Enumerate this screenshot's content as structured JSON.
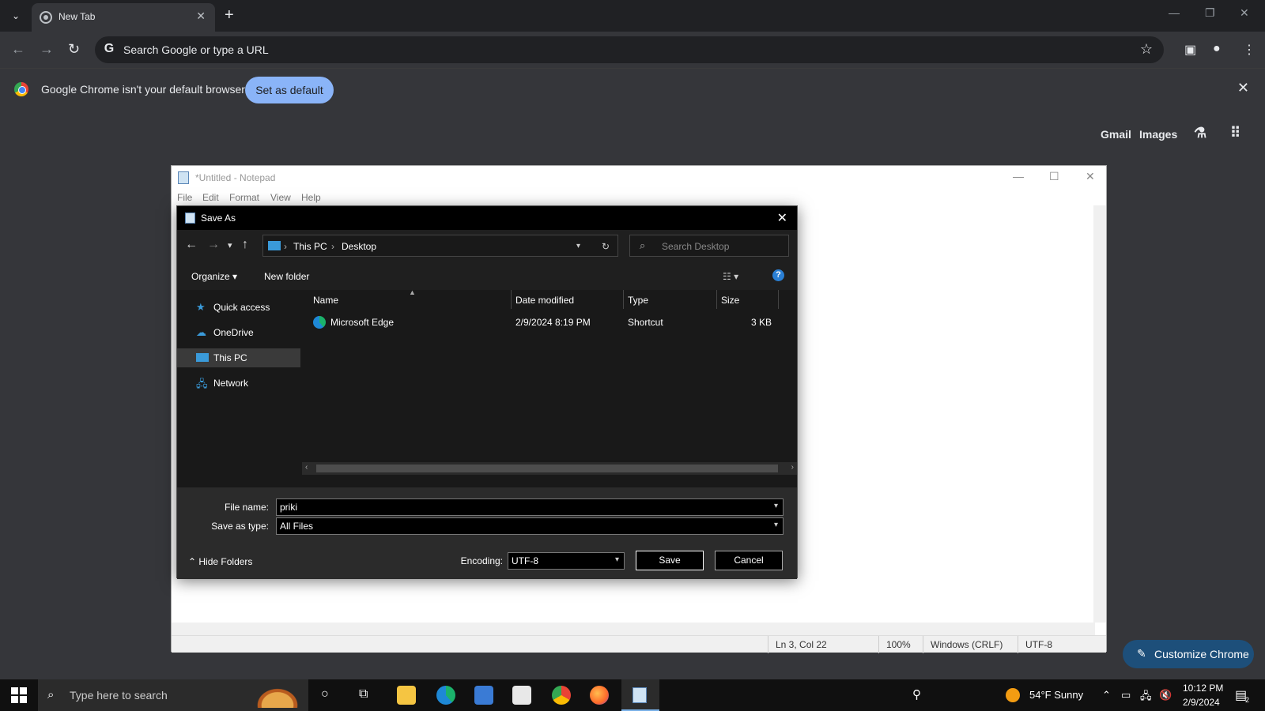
{
  "chrome": {
    "tab_title": "New Tab",
    "omnibox_placeholder": "Search Google or type a URL",
    "omnibox_logo": "G",
    "infobar_message": "Google Chrome isn't your default browser",
    "set_default_label": "Set as default",
    "ntp_links": [
      "Gmail",
      "Images"
    ],
    "customize_label": "Customize Chrome"
  },
  "notepad": {
    "title": "*Untitled - Notepad",
    "menu": [
      "File",
      "Edit",
      "Format",
      "View",
      "Help"
    ],
    "status": {
      "position": "Ln 3, Col 22",
      "zoom": "100%",
      "line_endings": "Windows (CRLF)",
      "encoding": "UTF-8"
    }
  },
  "save_as": {
    "title": "Save As",
    "path": [
      "This PC",
      "Desktop"
    ],
    "search_placeholder": "Search Desktop",
    "organize_label": "Organize",
    "new_folder_label": "New folder",
    "nav_items": [
      "Quick access",
      "OneDrive",
      "This PC",
      "Network"
    ],
    "selected_nav": "This PC",
    "columns": [
      "Name",
      "Date modified",
      "Type",
      "Size"
    ],
    "files": [
      {
        "name": "Microsoft Edge",
        "date": "2/9/2024 8:19 PM",
        "type": "Shortcut",
        "size": "3 KB"
      }
    ],
    "file_name_label": "File name:",
    "file_name_value": "priki",
    "save_type_label": "Save as type:",
    "save_type_value": "All Files",
    "hide_folders_label": "Hide Folders",
    "encoding_label": "Encoding:",
    "encoding_value": "UTF-8",
    "save_label": "Save",
    "cancel_label": "Cancel"
  },
  "taskbar": {
    "search_placeholder": "Type here to search",
    "weather": "54°F  Sunny",
    "time": "10:12 PM",
    "date": "2/9/2024",
    "notification_count": "2"
  }
}
